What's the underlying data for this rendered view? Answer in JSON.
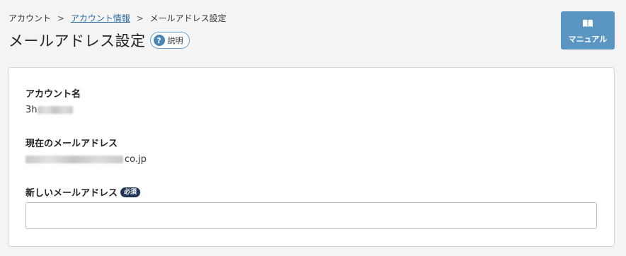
{
  "breadcrumb": {
    "items": [
      "アカウント",
      "アカウント情報",
      "メールアドレス設定"
    ],
    "separator": ">"
  },
  "header": {
    "title": "メールアドレス設定",
    "help_label": "説明",
    "help_icon": "question-circle-icon"
  },
  "manual_button": {
    "label": "マニュアル",
    "icon": "book-open-icon"
  },
  "form": {
    "account_name_label": "アカウント名",
    "account_name_visible_prefix": "3h",
    "current_email_label": "現在のメールアドレス",
    "current_email_visible_suffix": "co.jp",
    "new_email_label": "新しいメールアドレス",
    "required_badge": "必須",
    "new_email_value": ""
  },
  "colors": {
    "accent": "#5b96c2",
    "link": "#2a6a9b",
    "badge": "#1f3554",
    "background": "#f4f4f5"
  }
}
